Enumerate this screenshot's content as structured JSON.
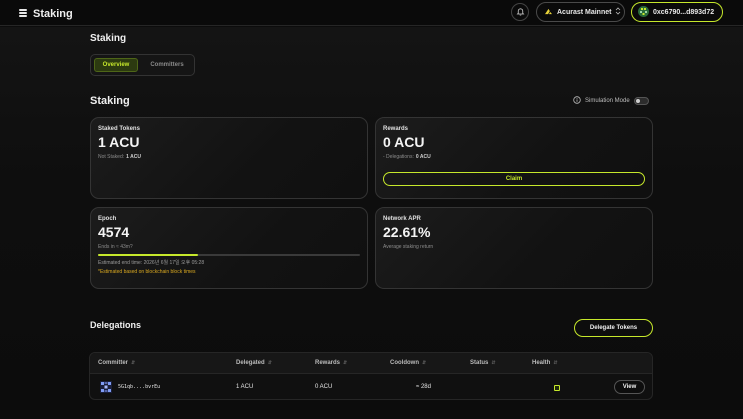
{
  "header": {
    "app_title": "Staking",
    "network_label": "Acurast Mainnet",
    "wallet_address": "0xc6790...d893d72"
  },
  "page": {
    "title": "Staking",
    "tabs": [
      {
        "label": "Overview"
      },
      {
        "label": "Committers"
      }
    ]
  },
  "staking": {
    "section_title": "Staking",
    "simulation_label": "Simulation Mode",
    "cards": {
      "staked": {
        "label": "Staked Tokens",
        "value": "1 ACU",
        "sub_label": "Not Staked:",
        "sub_value": "1 ACU"
      },
      "rewards": {
        "label": "Rewards",
        "value": "0 ACU",
        "sub_label": "- Delegations:",
        "sub_value": "0 ACU",
        "button": "Claim"
      },
      "epoch": {
        "label": "Epoch",
        "value": "4574",
        "sub_label": "Ends in ≈ 43m?",
        "progress": 0.38,
        "estimated": "Estimated end time: 2026년 6월 17일 오후 05:28",
        "note": "*Estimated based on blockchain block times"
      },
      "apr": {
        "label": "Network APR",
        "value": "22.61%",
        "sub_label": "Average staking return"
      }
    }
  },
  "delegations": {
    "title": "Delegations",
    "button": "Delegate Tokens",
    "columns": [
      "Committer",
      "Delegated",
      "Rewards",
      "Cooldown",
      "Status",
      "Health"
    ],
    "rows": [
      {
        "committer": "5G1qb....bvrEu",
        "delegated": "1 ACU",
        "rewards": "0 ACU",
        "cooldown": "≈ 28d",
        "status": "",
        "action": "View"
      }
    ]
  },
  "colors": {
    "accent": "#c6e82b",
    "background": "#0c0c0c"
  }
}
